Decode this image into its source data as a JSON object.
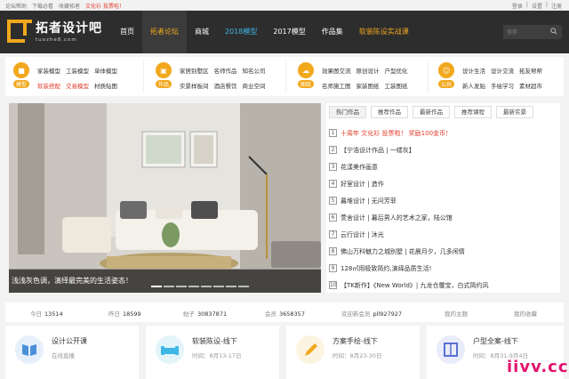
{
  "topbar": {
    "links": [
      "论坛帮助",
      "下载必看",
      "收藏拓者",
      "文化衫 投票啦！"
    ],
    "right": [
      "登录",
      "|",
      "设置",
      "|",
      "注册"
    ]
  },
  "header": {
    "logo_text": "拓者设计吧",
    "logo_sub": "tuozhe8.com",
    "nav": [
      "首页",
      "拓者论坛",
      "商城",
      "2018模型",
      "2017模型",
      "作品集",
      "软装陈设实战课"
    ],
    "search_placeholder": "搜索"
  },
  "categories": [
    {
      "badge": "模型",
      "icon": "cube-icon",
      "color": "#f2a81d",
      "links": [
        "家装模型",
        "工装模型",
        "单体模型",
        "软装搭配",
        "交易模型",
        "材质贴图"
      ],
      "hot": [
        3,
        4
      ]
    },
    {
      "badge": "作品",
      "icon": "image-icon",
      "color": "#f2a81d",
      "links": [
        "家居别墅区",
        "名师作品",
        "知名公司",
        "实景样板间",
        "酒店餐饮",
        "商业空间"
      ],
      "hot": []
    },
    {
      "badge": "图纸",
      "icon": "cloud-icon",
      "color": "#f2a81d",
      "links": [
        "效果图交流",
        "原创设计",
        "户型优化",
        "名师施工图",
        "家装图纸",
        "工装图纸"
      ],
      "hot": []
    },
    {
      "badge": "公共",
      "icon": "people-icon",
      "color": "#f2a81d",
      "links": [
        "设计生活",
        "设计交流",
        "拓友帮帮",
        "新人发贴",
        "手绘学习",
        "素材超市"
      ],
      "hot": []
    }
  ],
  "slider": {
    "caption": "浅浅灰色调，演绎最完美的生活姿态！",
    "active_index": 0,
    "count": 8
  },
  "news": {
    "tabs": [
      "热门作品",
      "推荐作品",
      "最新作品",
      "推荐课程",
      "最新实景"
    ],
    "items": [
      "十周年 文化衫 投票啦！ 奖励100金币！",
      "【宁浩设计作品 | 一缕灰】",
      "花漾美作画意",
      "好室设计 | 造作",
      "暮堆设计 | 无问芳菲",
      "萱舍设计 | 暮后男人的艺术之家，陆公馆",
      "云行设计 | 沐光",
      "佛山万科魅力之城别墅 | 花晨月夕，几多闲情",
      "128㎡用极致简约,演绎品质生活!",
      "【TK新作】《New World》| 九龙仓璽宝，白式简约风"
    ]
  },
  "stats": {
    "today_label": "今日",
    "today": "13514",
    "yesterday_label": "昨日",
    "yesterday": "18599",
    "posts_label": "帖子",
    "posts": "30837871",
    "members_label": "会员",
    "members": "3658357",
    "welcome_label": "欢迎新会员",
    "welcome": "pll927927",
    "my_posts": "我的主题",
    "my_favorites": "我的收藏"
  },
  "cards": [
    {
      "title": "设计公开课",
      "desc": "在线直播",
      "icon": "book-icon",
      "color": "#4a90d9"
    },
    {
      "title": "软装陈设-线下",
      "desc": "时间：8月13-17日",
      "icon": "sofa-icon",
      "color": "#3fb7e6"
    },
    {
      "title": "方案手绘-线下",
      "desc": "时间：8月23-30日",
      "icon": "pen-icon",
      "color": "#f2a81d"
    },
    {
      "title": "户型全案-线下",
      "desc": "时间：8月31-9月4日",
      "icon": "plan-icon",
      "color": "#5b6fcf"
    }
  ],
  "watermark": "iivv.cc"
}
